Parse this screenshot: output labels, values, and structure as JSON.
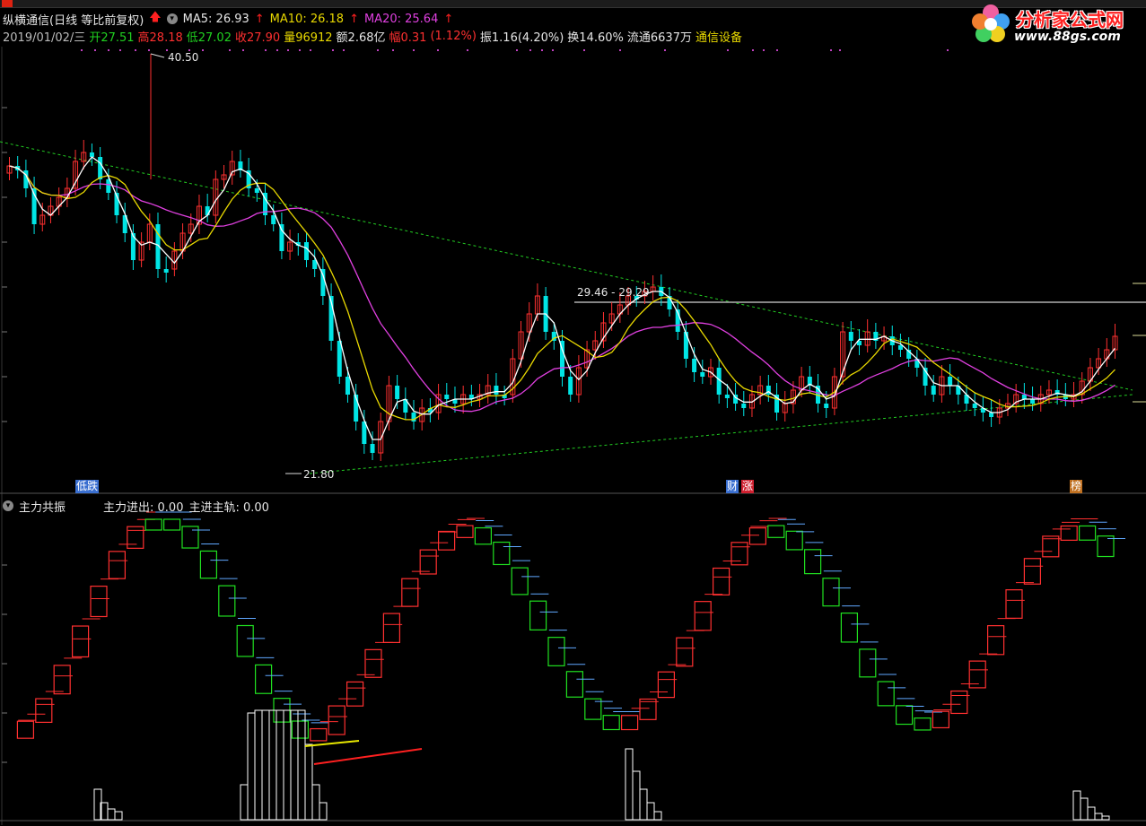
{
  "header": {
    "stock_title": "纵横通信(日线 等比前复权)",
    "ma5_label": "MA5: 26.93",
    "ma10_label": "MA10: 26.18",
    "ma20_label": "MA20: 25.64",
    "date": "2019/01/02/三",
    "open": "开27.51",
    "high": "高28.18",
    "low": "低27.02",
    "close": "收27.90",
    "volume": "量96912",
    "amount": "额2.68亿",
    "change": "幅0.31",
    "change_pct": "(1.12%)",
    "amplitude": "振1.16(4.20%)",
    "turnover": "换14.60%",
    "float_shares": "流通6637万",
    "sector": "通信设备"
  },
  "watermark": {
    "title": "分析家公式网",
    "url": "www.88gs.com"
  },
  "annotations": {
    "high_price": "40.50",
    "low_price": "21.80",
    "range_label": "29.46 - 29.29"
  },
  "markers": {
    "m1": "低跌",
    "m2a": "财",
    "m2b": "涨",
    "m3": "榜"
  },
  "sub_panel": {
    "name": "主力共振",
    "zljc": "主力进出: 0.00",
    "zjzg": "主进主轨: 0.00"
  },
  "colors": {
    "up": "#ff3030",
    "down": "#00e5e5",
    "ma5": "#ffffff",
    "ma10": "#e8d800",
    "ma20": "#e040e0",
    "trend": "#22cc22"
  }
}
